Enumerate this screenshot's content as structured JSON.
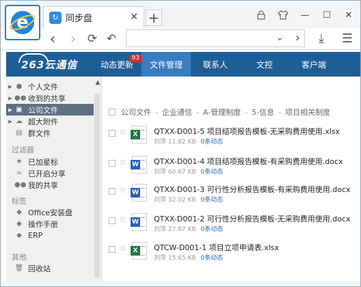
{
  "browser": {
    "tab_title": "同步盘",
    "tab_close": "✕",
    "new_tab": "+",
    "url_placeholder": "",
    "win": {
      "lock": "🔒",
      "shirt": "👕",
      "min": "—",
      "max": "☐",
      "close": "✕"
    }
  },
  "app": {
    "logo": "263云通信",
    "menu": [
      {
        "label": "动态更新",
        "badge": "93"
      },
      {
        "label": "文件管理"
      },
      {
        "label": "联系人"
      },
      {
        "label": "文控"
      },
      {
        "label": "客户端"
      }
    ]
  },
  "sidebar": {
    "items": [
      {
        "label": "个人文件"
      },
      {
        "label": "收到的共享"
      },
      {
        "label": "公司文件"
      },
      {
        "label": "超大附件"
      },
      {
        "label": "群文件"
      }
    ],
    "sections": {
      "filters": "过滤器",
      "tags": "标签",
      "other": "其他"
    },
    "filters": [
      {
        "label": "已加星标"
      },
      {
        "label": "已开启分享"
      },
      {
        "label": "我的共享"
      }
    ],
    "tags": [
      {
        "label": "Office安装盘"
      },
      {
        "label": "操作手册"
      },
      {
        "label": "ERP"
      }
    ],
    "other": [
      {
        "label": "回收站"
      }
    ]
  },
  "breadcrumb": [
    "公司文件",
    "企业通信",
    "A-管理制度",
    "5-信息",
    "项目相关制度"
  ],
  "files": [
    {
      "name": "QTXX-D001-5 项目结项报告模板-无采购费用使用.xlsx",
      "owner": "刘萍",
      "size": "11.82 KB",
      "activity": "0条动态",
      "type": "x"
    },
    {
      "name": "QTXX-D001-4 项目结项报告模板-有采购费用使用.docx",
      "owner": "刘萍",
      "size": "60.67 KB",
      "activity": "0条动态",
      "type": "w"
    },
    {
      "name": "QTXX-D001-3 可行性分析报告模板-有采购费用使用.docx",
      "owner": "刘萍",
      "size": "32.02 KB",
      "activity": "0条动态",
      "type": "w"
    },
    {
      "name": "QTXX-D001-2 可行性分析报告模板-无采购费用使用.docx",
      "owner": "刘萍",
      "size": "27.87 KB",
      "activity": "0条动态",
      "type": "w"
    },
    {
      "name": "QTCW-D001-1 项目立项申请表.xlsx",
      "owner": "刘萍",
      "size": "15.65 KB",
      "activity": "0条动态",
      "type": "x"
    }
  ],
  "colors": {
    "header": "#1e5e96",
    "active_tab": "#3a7cc0",
    "selected_sidebar": "#5e6f80",
    "badge": "#e02a2a"
  }
}
